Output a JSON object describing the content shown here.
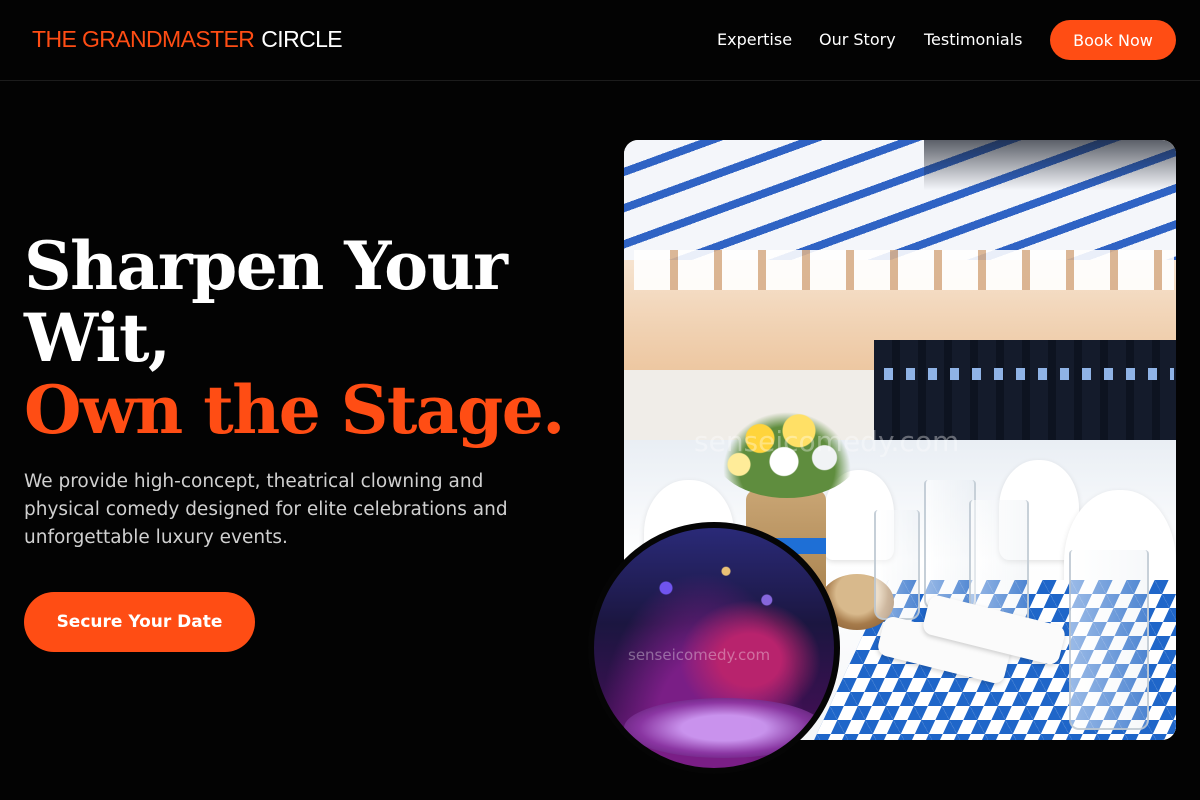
{
  "brand": {
    "part1": "THE GRANDMASTER",
    "part2": "CIRCLE",
    "accent_color": "#ff4d14"
  },
  "nav": {
    "links": [
      "Expertise",
      "Our Story",
      "Testimonials"
    ],
    "cta_label": "Book Now"
  },
  "hero": {
    "title_line1": "Sharpen Your Wit,",
    "title_line2": "Own the Stage.",
    "description": "We provide high-concept, theatrical clowning and physical comedy designed for elite celebrations and unforgettable luxury events.",
    "cta_label": "Secure Your Date"
  },
  "images": {
    "main_photo_watermark": "senseicomedy.com",
    "circle_photo_watermark": "senseicomedy.com"
  }
}
